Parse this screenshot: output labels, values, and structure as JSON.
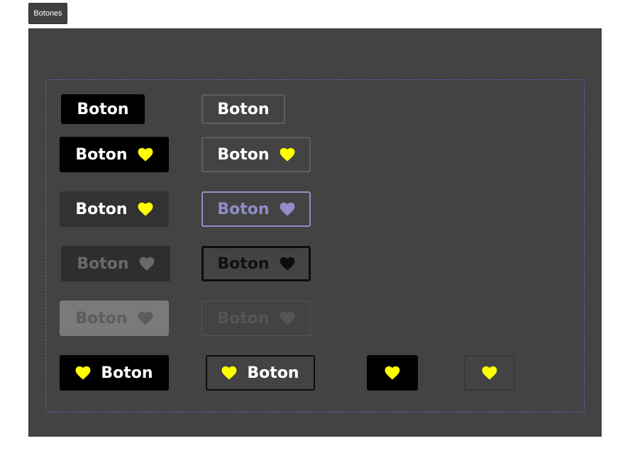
{
  "frame": {
    "title": "Botones"
  },
  "buttons": {
    "label": "Boton"
  },
  "colors": {
    "heart_yellow": "#ffff00",
    "heart_lavender": "#8f8ec8",
    "heart_gray_active": "#6a6a6a",
    "heart_black": "#0d0d0d",
    "heart_disabled_solid": "#5c5c5c",
    "heart_disabled_outline": "#555555",
    "guide_purple": "#8a4bdb",
    "canvas_bg": "#434343"
  },
  "icons": {
    "heart": "heart-icon"
  }
}
